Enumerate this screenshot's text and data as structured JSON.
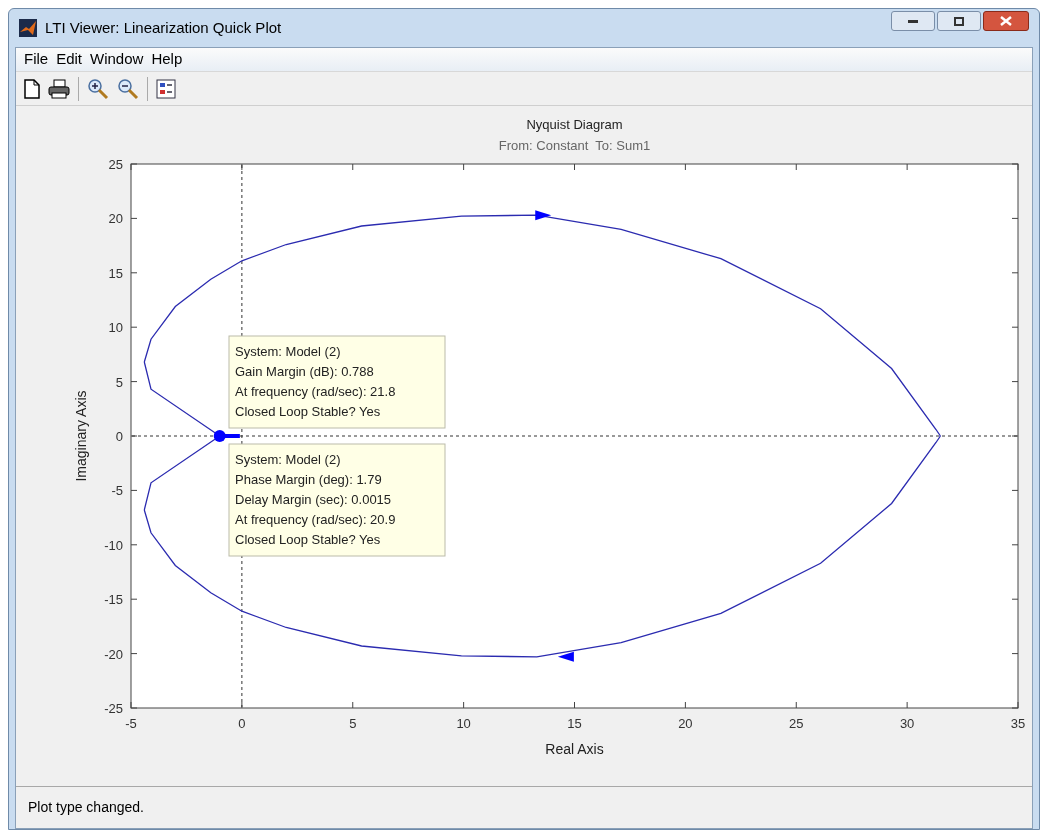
{
  "window": {
    "title": "LTI Viewer: Linearization Quick Plot"
  },
  "menu": [
    "File",
    "Edit",
    "Window",
    "Help"
  ],
  "plot": {
    "title": "Nyquist Diagram",
    "subtitle": "From: Constant  To: Sum1",
    "chart_data": {
      "type": "line",
      "xlabel": "Real Axis",
      "ylabel": "Imaginary Axis",
      "xlim": [
        -5,
        35
      ],
      "ylim": [
        -25,
        25
      ],
      "xticks": [
        -5,
        0,
        5,
        10,
        15,
        20,
        25,
        30,
        35
      ],
      "yticks": [
        -25,
        -20,
        -15,
        -10,
        -5,
        0,
        5,
        10,
        15,
        20,
        25
      ],
      "series": [
        {
          "color": "#2b2bb0",
          "x": [
            -4.4,
            -4.1,
            -1
          ],
          "values": [
            6.8,
            4.3,
            0
          ]
        },
        {
          "color": "#2b2bb0",
          "x": [
            -4.4,
            -4.1,
            -3,
            -1.4,
            0,
            2,
            5.4,
            9.9,
            13.3,
            17.1,
            21.6,
            26.1,
            29.3,
            31.3,
            31.5
          ],
          "values": [
            6.8,
            8.9,
            11.9,
            14.4,
            16.1,
            17.6,
            19.3,
            20.2,
            20.3,
            19,
            16.3,
            11.7,
            6.2,
            0.6,
            0
          ]
        },
        {
          "color": "#2b2bb0",
          "x": [
            -4.4,
            -4.1,
            -3,
            -1.4,
            0,
            2,
            5.4,
            9.9,
            13.3,
            17.1,
            21.6,
            26.1,
            29.3,
            31.3,
            31.5
          ],
          "values": [
            -6.8,
            -8.9,
            -11.9,
            -14.4,
            -16.1,
            -17.6,
            -19.3,
            -20.2,
            -20.3,
            -19,
            -16.3,
            -11.7,
            -6.2,
            -0.6,
            0
          ]
        },
        {
          "color": "#2b2bb0",
          "x": [
            -4.4,
            -4.1,
            -1
          ],
          "values": [
            -6.8,
            -4.3,
            0
          ]
        }
      ]
    },
    "data_tips": [
      {
        "lines": [
          "System: Model (2)",
          "Gain Margin (dB): 0.788",
          "At frequency (rad/sec): 21.8",
          "Closed Loop Stable? Yes"
        ]
      },
      {
        "lines": [
          "System: Model (2)",
          "Phase Margin (deg): 1.79",
          "Delay Margin (sec): 0.0015",
          "At frequency (rad/sec): 20.9",
          "Closed Loop Stable? Yes"
        ]
      }
    ]
  },
  "status_bar": "Plot type changed."
}
